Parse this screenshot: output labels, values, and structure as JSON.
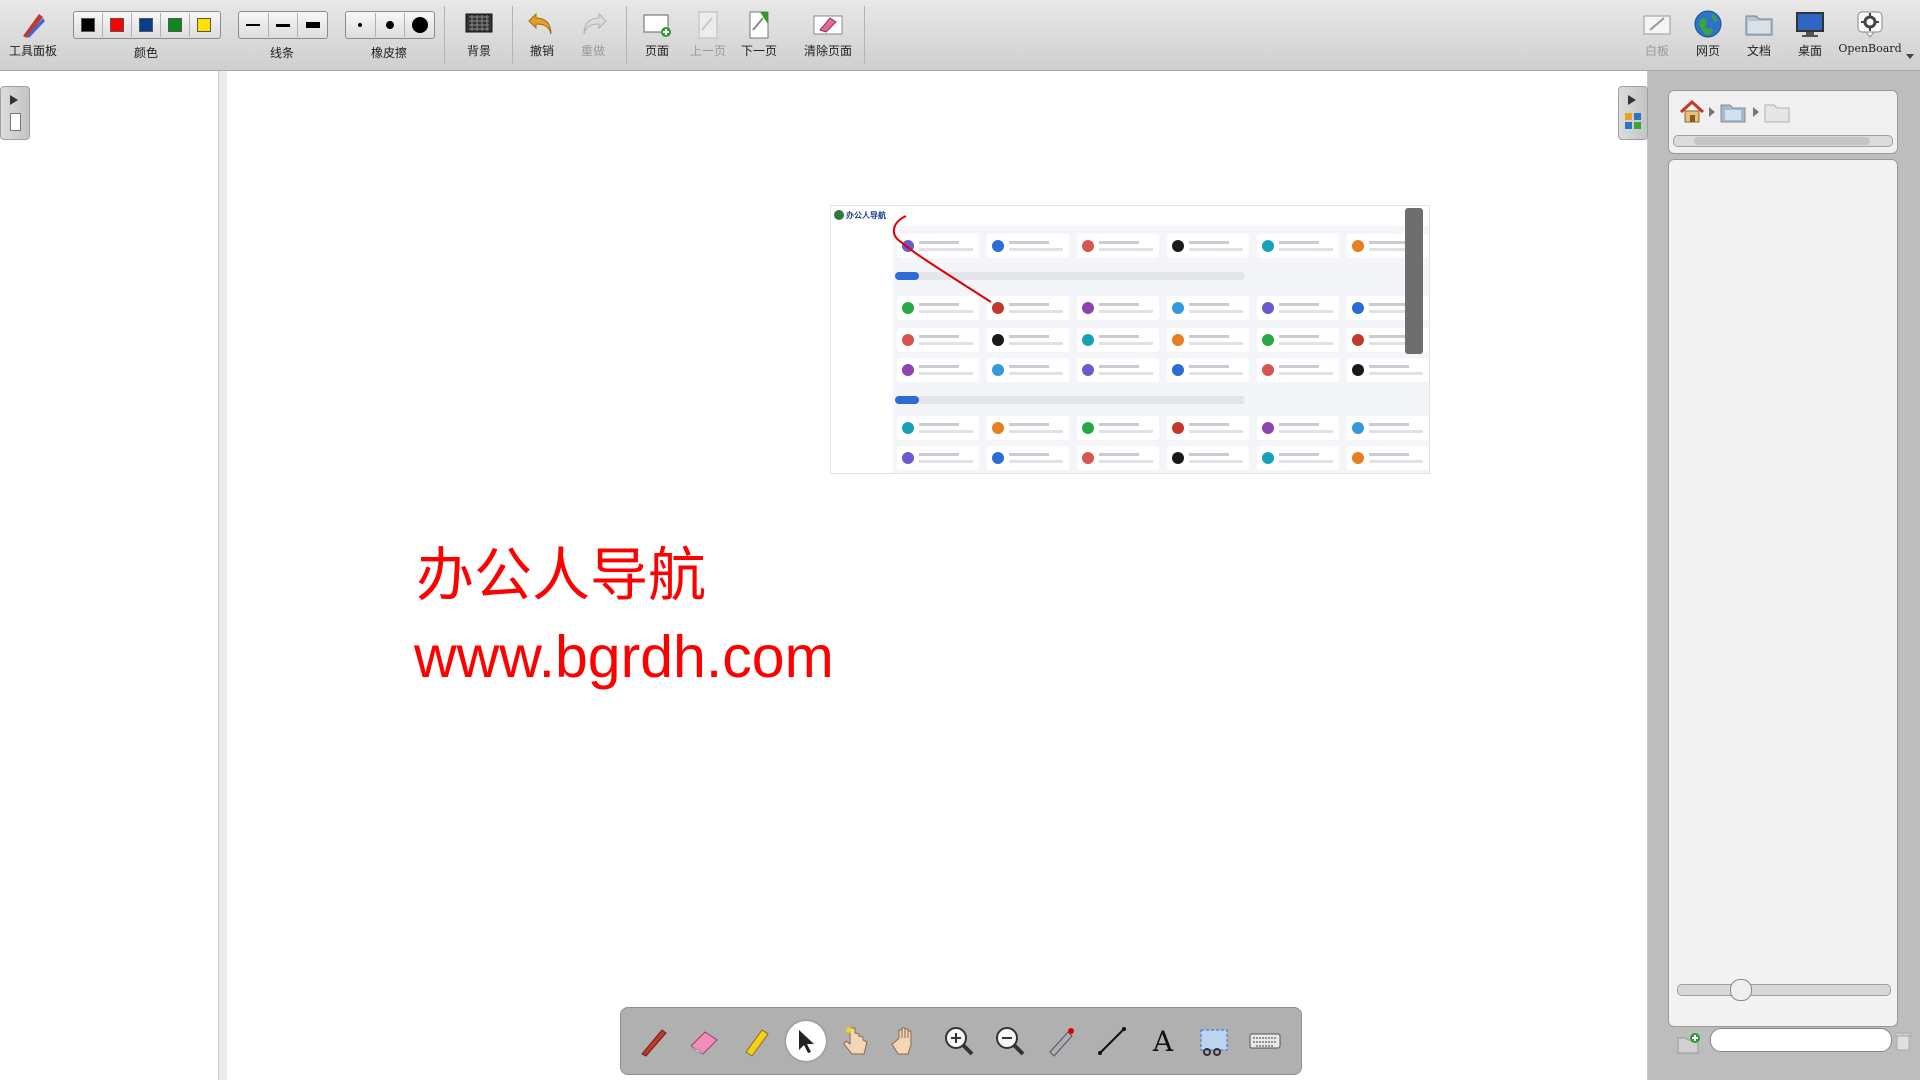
{
  "toolbar": {
    "tool_panel": "工具面板",
    "color": "颜色",
    "line": "线条",
    "eraser": "橡皮擦",
    "background": "背景",
    "undo": "撤销",
    "redo": "重做",
    "page": "页面",
    "prev_page": "上一页",
    "next_page": "下一页",
    "clear_page": "清除页面",
    "whiteboard": "白板",
    "web": "网页",
    "document": "文档",
    "desktop": "桌面",
    "openboard": "OpenBoard"
  },
  "colors": [
    "#000000",
    "#ff0000",
    "#0a3c8c",
    "#0a8a1e",
    "#ffe000"
  ],
  "board": {
    "title_text": "办公人导航",
    "url_text": "www.bgrdh.com",
    "text_color": "#ff0000",
    "embedded_screenshot": {
      "logo_text": "办公人导航"
    }
  },
  "bottom_tools": [
    "pen-icon",
    "eraser-icon",
    "marker-icon",
    "selector-icon",
    "interact-icon",
    "hand-icon",
    "zoom-in-icon",
    "zoom-out-icon",
    "laser-pointer-icon",
    "line-icon",
    "text-icon",
    "capture-icon",
    "keyboard-icon"
  ],
  "text_tool_label": "A"
}
